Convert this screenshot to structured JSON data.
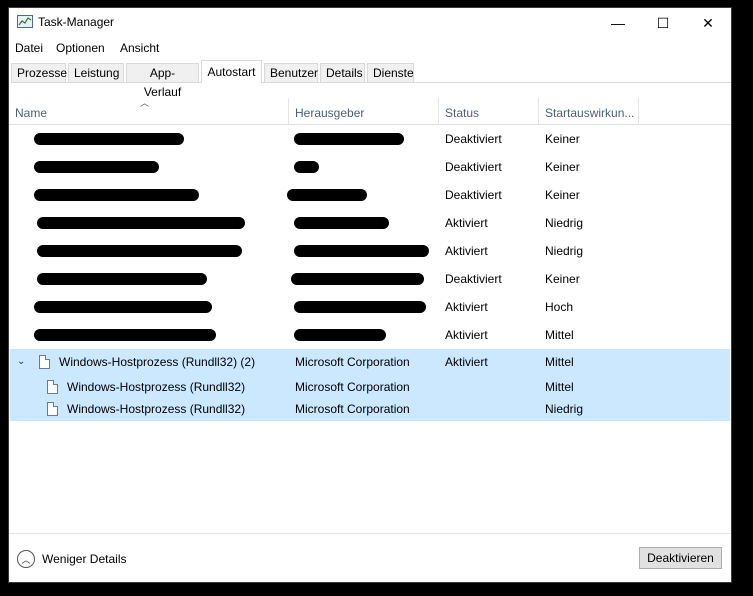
{
  "window": {
    "title": "Task-Manager",
    "controls": {
      "minimize": "—",
      "maximize": "☐",
      "close": "✕"
    }
  },
  "menu": [
    "Datei",
    "Optionen",
    "Ansicht"
  ],
  "tabs": [
    "Prozesse",
    "Leistung",
    "App-Verlauf",
    "Autostart",
    "Benutzer",
    "Details",
    "Dienste"
  ],
  "active_tab": "Autostart",
  "columns": {
    "name": "Name",
    "publisher": "Herausgeber",
    "status": "Status",
    "impact": "Startauswirkun..."
  },
  "rows": [
    {
      "status": "Deaktiviert",
      "impact": "Keiner"
    },
    {
      "status": "Deaktiviert",
      "impact": "Keiner"
    },
    {
      "status": "Deaktiviert",
      "impact": "Keiner"
    },
    {
      "status": "Aktiviert",
      "impact": "Niedrig"
    },
    {
      "status": "Aktiviert",
      "impact": "Niedrig"
    },
    {
      "status": "Deaktiviert",
      "impact": "Keiner"
    },
    {
      "status": "Aktiviert",
      "impact": "Hoch"
    },
    {
      "status": "Aktiviert",
      "impact": "Mittel"
    }
  ],
  "group": {
    "name": "Windows-Hostprozess (Rundll32) (2)",
    "publisher": "Microsoft Corporation",
    "status": "Aktiviert",
    "impact": "Mittel",
    "children": [
      {
        "name": "Windows-Hostprozess (Rundll32)",
        "publisher": "Microsoft Corporation",
        "impact": "Mittel"
      },
      {
        "name": "Windows-Hostprozess (Rundll32)",
        "publisher": "Microsoft Corporation",
        "impact": "Niedrig"
      }
    ]
  },
  "footer": {
    "fewer_details": "Weniger Details",
    "disable_button": "Deaktivieren"
  }
}
